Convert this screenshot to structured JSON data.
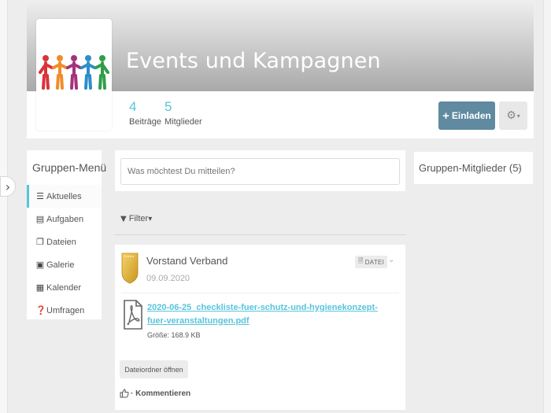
{
  "group": {
    "title": "Events und Kampagnen",
    "stats": [
      {
        "value": "4",
        "label": "Beiträge"
      },
      {
        "value": "5",
        "label": "Mitglieder"
      }
    ],
    "invite_label": "Einladen",
    "invite_icon": "plus-icon",
    "settings_icon": "gear-icon"
  },
  "menu": {
    "title": "Gruppen-Menü",
    "items": [
      {
        "label": "Aktuelles",
        "icon": "list-icon",
        "glyph": "☰",
        "active": true
      },
      {
        "label": "Aufgaben",
        "icon": "tasks-icon",
        "glyph": "▤"
      },
      {
        "label": "Dateien",
        "icon": "files-icon",
        "glyph": "❐"
      },
      {
        "label": "Galerie",
        "icon": "image-icon",
        "glyph": "▣"
      },
      {
        "label": "Kalender",
        "icon": "calendar-icon",
        "glyph": "▦"
      },
      {
        "label": "Umfragen",
        "icon": "question-icon",
        "glyph": "❓"
      }
    ]
  },
  "composer": {
    "placeholder": "Was möchtest Du mitteilen?"
  },
  "filter": {
    "label": "Filter"
  },
  "post": {
    "author": "Vorstand Verband",
    "date": "09.09.2020",
    "badge": "DATEI",
    "file_name": "2020-06-25_checkliste-fuer-schutz-und-hygienekonzept-fuer-veranstaltungen.pdf",
    "file_size": "Größe: 168.9 KB",
    "open_folder_label": "Dateiordner öffnen",
    "comment_label": "Kommentieren"
  },
  "members": {
    "title": "Gruppen-Mitglieder (5)"
  },
  "colors": {
    "accent": "#58c4dc",
    "invite_button": "#5f8aa0",
    "banner_top": "#efefef",
    "banner_bottom": "#a9a9a9",
    "background": "#ededed"
  }
}
